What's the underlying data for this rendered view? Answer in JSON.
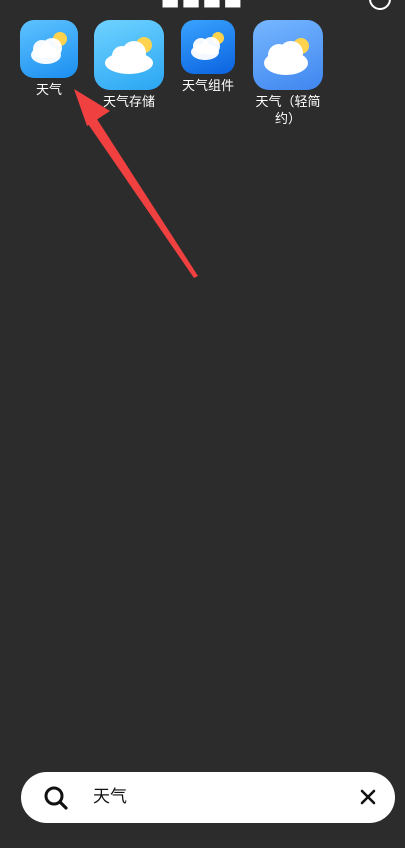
{
  "header": {
    "title": "■■■■"
  },
  "apps": [
    {
      "label": "天气",
      "icon": "weather-cloud-sun-icon"
    },
    {
      "label": "天气存储",
      "icon": "weather-cloud-sun-icon"
    },
    {
      "label": "天气组件",
      "icon": "weather-cloud-sun-icon"
    },
    {
      "label": "天气（轻简\n约）",
      "icon": "weather-cloud-sun-icon"
    }
  ],
  "search": {
    "value": "天气",
    "icon": "search-icon",
    "clear_icon": "close-icon"
  },
  "annotation": {
    "color": "#f04040"
  }
}
